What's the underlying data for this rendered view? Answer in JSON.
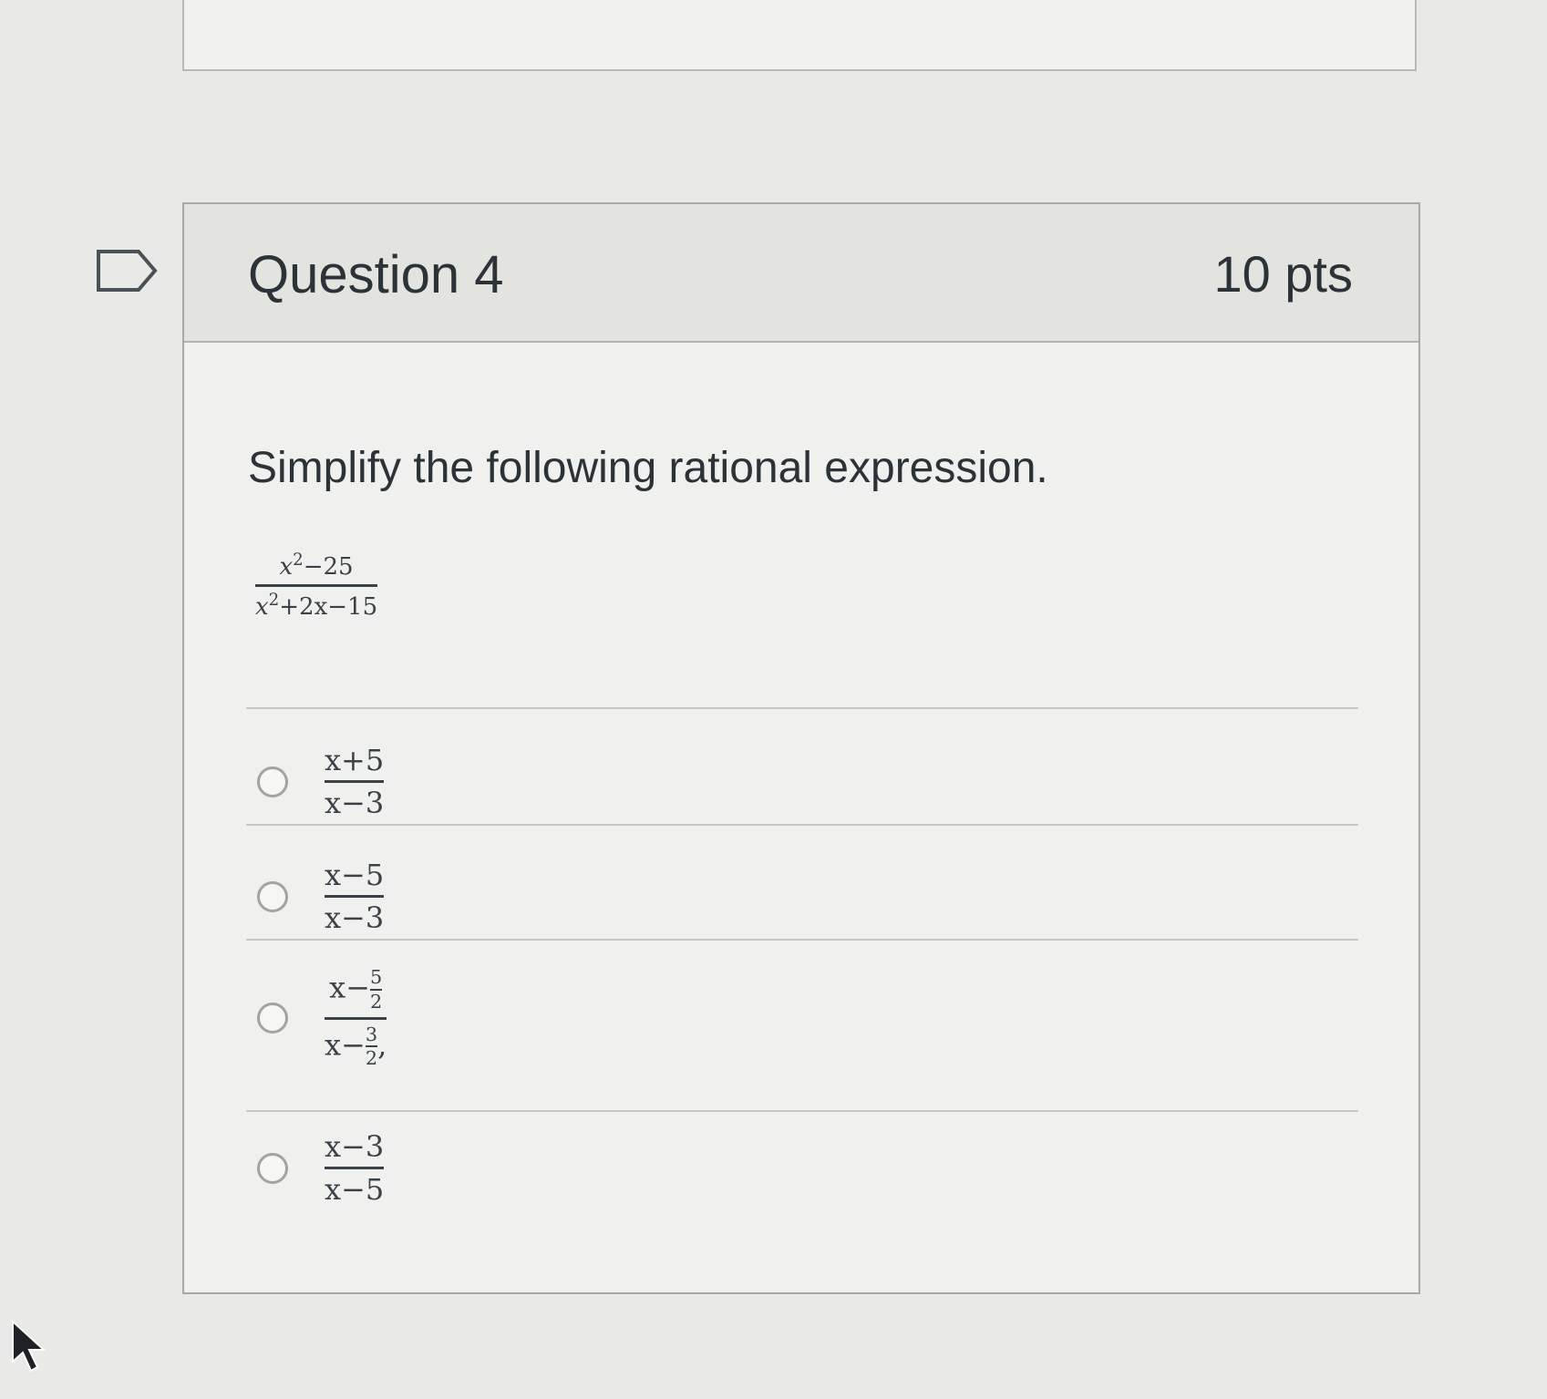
{
  "question": {
    "title": "Question 4",
    "points": "10 pts",
    "prompt": "Simplify the following rational expression.",
    "expression": {
      "numerator": {
        "var": "x",
        "exp": "2",
        "rest": "−25"
      },
      "denominator": {
        "var": "x",
        "exp": "2",
        "rest": "+2x−15"
      }
    }
  },
  "answers": [
    {
      "numerator": "x+5",
      "denominator": "x−3",
      "selected": false
    },
    {
      "numerator": "x−5",
      "denominator": "x−3",
      "selected": false
    },
    {
      "numerator": {
        "lead": "x−",
        "num": "5",
        "den": "2"
      },
      "denominator": {
        "lead": "x−",
        "num": "3",
        "den": "2"
      },
      "trailing": ",",
      "selected": false
    },
    {
      "numerator": "x−3",
      "denominator": "x−5",
      "selected": false
    }
  ],
  "icons": {
    "flag": "flag-icon",
    "cursor": "cursor-icon"
  }
}
